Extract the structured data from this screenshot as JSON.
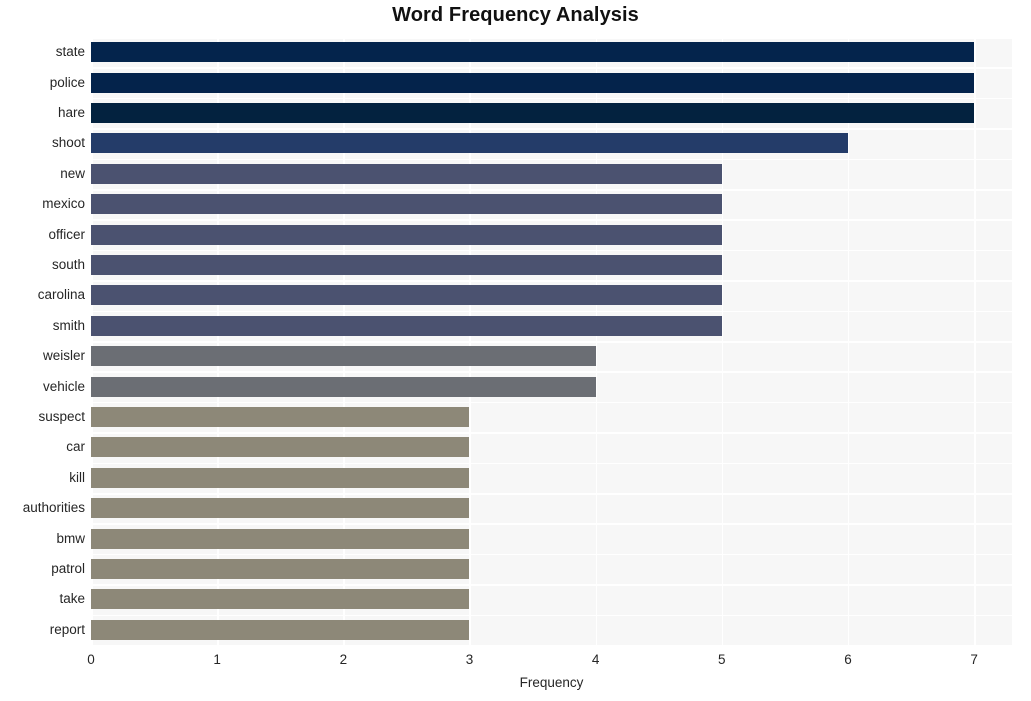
{
  "chart_data": {
    "type": "bar",
    "orientation": "horizontal",
    "title": "Word Frequency Analysis",
    "xlabel": "Frequency",
    "ylabel": "",
    "xlim": [
      0,
      7.3
    ],
    "xticks": [
      0,
      1,
      2,
      3,
      4,
      5,
      6,
      7
    ],
    "xtick_labels": [
      "0",
      "1",
      "2",
      "3",
      "4",
      "5",
      "6",
      "7"
    ],
    "grid": true,
    "grid_color": "#ffffff",
    "plot_background": "#f7f7f7",
    "figure_background": "#ffffff",
    "legend": null,
    "categories": [
      "state",
      "police",
      "hare",
      "shoot",
      "new",
      "mexico",
      "officer",
      "south",
      "carolina",
      "smith",
      "weisler",
      "vehicle",
      "suspect",
      "car",
      "kill",
      "authorities",
      "bmw",
      "patrol",
      "take",
      "report"
    ],
    "values": [
      7,
      7,
      7,
      6,
      5,
      5,
      5,
      5,
      5,
      5,
      4,
      4,
      3,
      3,
      3,
      3,
      3,
      3,
      3,
      3
    ],
    "bar_colors": [
      "#04244c",
      "#04234b",
      "#03223f",
      "#243c69",
      "#4b5270",
      "#4b5270",
      "#4b5270",
      "#4b5270",
      "#4b5270",
      "#4b5270",
      "#6b6e74",
      "#6b6e74",
      "#8d8878",
      "#8d8878",
      "#8d8878",
      "#8d8878",
      "#8d8878",
      "#8d8878",
      "#8d8878",
      "#8d8878"
    ],
    "bars": [
      {
        "label": "state",
        "value": 7,
        "color": "#04244c"
      },
      {
        "label": "police",
        "value": 7,
        "color": "#04234b"
      },
      {
        "label": "hare",
        "value": 7,
        "color": "#03223f"
      },
      {
        "label": "shoot",
        "value": 6,
        "color": "#243c69"
      },
      {
        "label": "new",
        "value": 5,
        "color": "#4b5270"
      },
      {
        "label": "mexico",
        "value": 5,
        "color": "#4b5270"
      },
      {
        "label": "officer",
        "value": 5,
        "color": "#4b5270"
      },
      {
        "label": "south",
        "value": 5,
        "color": "#4b5270"
      },
      {
        "label": "carolina",
        "value": 5,
        "color": "#4b5270"
      },
      {
        "label": "smith",
        "value": 5,
        "color": "#4b5270"
      },
      {
        "label": "weisler",
        "value": 4,
        "color": "#6b6e74"
      },
      {
        "label": "vehicle",
        "value": 4,
        "color": "#6b6e74"
      },
      {
        "label": "suspect",
        "value": 3,
        "color": "#8d8878"
      },
      {
        "label": "car",
        "value": 3,
        "color": "#8d8878"
      },
      {
        "label": "kill",
        "value": 3,
        "color": "#8d8878"
      },
      {
        "label": "authorities",
        "value": 3,
        "color": "#8d8878"
      },
      {
        "label": "bmw",
        "value": 3,
        "color": "#8d8878"
      },
      {
        "label": "patrol",
        "value": 3,
        "color": "#8d8878"
      },
      {
        "label": "take",
        "value": 3,
        "color": "#8d8878"
      },
      {
        "label": "report",
        "value": 3,
        "color": "#8d8878"
      }
    ]
  }
}
